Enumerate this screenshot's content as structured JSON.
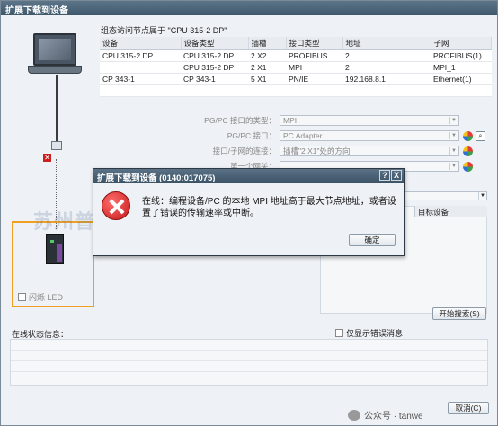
{
  "window": {
    "title": "扩展下载到设备"
  },
  "group": {
    "title": "组态访问节点属于 \"CPU 315-2 DP\""
  },
  "device_table": {
    "headers": [
      "设备",
      "设备类型",
      "插槽",
      "接口类型",
      "地址",
      "子网"
    ],
    "rows": [
      [
        "CPU 315-2 DP",
        "CPU 315-2 DP",
        "2 X2",
        "PROFIBUS",
        "2",
        "PROFIBUS(1)"
      ],
      [
        "",
        "CPU 315-2 DP",
        "2 X1",
        "MPI",
        "2",
        "MPI_1"
      ],
      [
        "CP 343-1",
        "CP 343-1",
        "5 X1",
        "PN/IE",
        "192.168.8.1",
        "Ethernet(1)"
      ]
    ]
  },
  "form": {
    "pgpc_type_label": "PG/PC 接口的类型：",
    "pgpc_type_value": "MPI",
    "pgpc_if_label": "PG/PC 接口：",
    "pgpc_if_value": "PC Adapter",
    "conn_label": "接口/子网的连接：",
    "conn_value": "插槽\"2 X1\"处的方向",
    "gateway_label": "第一个网关："
  },
  "target": {
    "column_header": "目标设备"
  },
  "flash_led": {
    "label": "闪烁 LED"
  },
  "buttons": {
    "start_search": "开始搜索(S)",
    "ok": "确定",
    "cancel": "取消(C)"
  },
  "status": {
    "label": "在线状态信息：",
    "errors_only": "仅显示错误消息"
  },
  "watermark": {
    "text": "公众号 · tanwe",
    "overlay": "苏州普迪达电气自动化技术有限公司"
  },
  "dialog": {
    "title": "扩展下载到设备 (0140:017075)",
    "help": "?",
    "close": "X",
    "message": "在线：编程设备/PC 的本地 MPI 地址高于最大节点地址，或者设置了错误的传输速率或中断。",
    "icon": "error-icon"
  }
}
